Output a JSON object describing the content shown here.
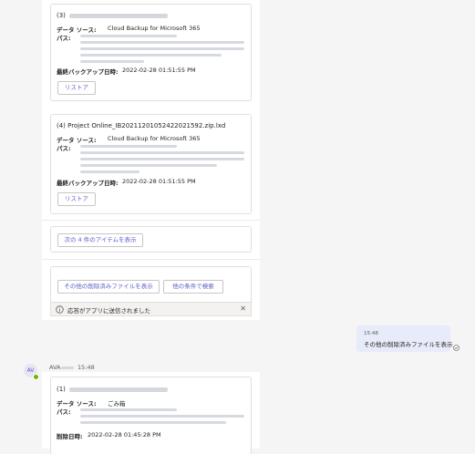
{
  "cards": [
    {
      "title": "(3)",
      "data_source_label": "データ ソース:",
      "data_source_value": "Cloud Backup for Microsoft 365",
      "path_label": "パス:",
      "date_label": "最終バックアップ日時:",
      "date_value": "2022-02-28 01:51:55 PM",
      "restore_label": "リストア"
    },
    {
      "title": "(4) Project Online_IB20211201052422021592.zip.lxd",
      "data_source_label": "データ ソース:",
      "data_source_value": "Cloud Backup for Microsoft 365",
      "path_label": "パス:",
      "date_label": "最終バックアップ日時:",
      "date_value": "2022-02-28 01:51:55 PM",
      "restore_label": "リストア"
    }
  ],
  "show_next_label": "次の 4 件のアイテムを表示",
  "show_deleted_label": "その他の削除済みファイルを表示",
  "search_other_label": "他の条件で検索",
  "notice_text": "応答がアプリに送信されました",
  "user_message": {
    "time": "15:48",
    "text": "その他の削除済みファイルを表示"
  },
  "bot": {
    "avatar_text": "AV",
    "name": "AVA",
    "time": "15:48"
  },
  "bot_card": {
    "title": "(1)",
    "data_source_label": "データ ソース:",
    "data_source_value": "ごみ箱",
    "path_label": "パス:",
    "date_label": "削除日時:",
    "date_value": "2022-02-28 01:45:28 PM"
  },
  "colors": {
    "accent": "#5b5fc7",
    "bubble": "#e8ebfa",
    "background": "#f5f5f5",
    "presence": "#6bb700"
  }
}
